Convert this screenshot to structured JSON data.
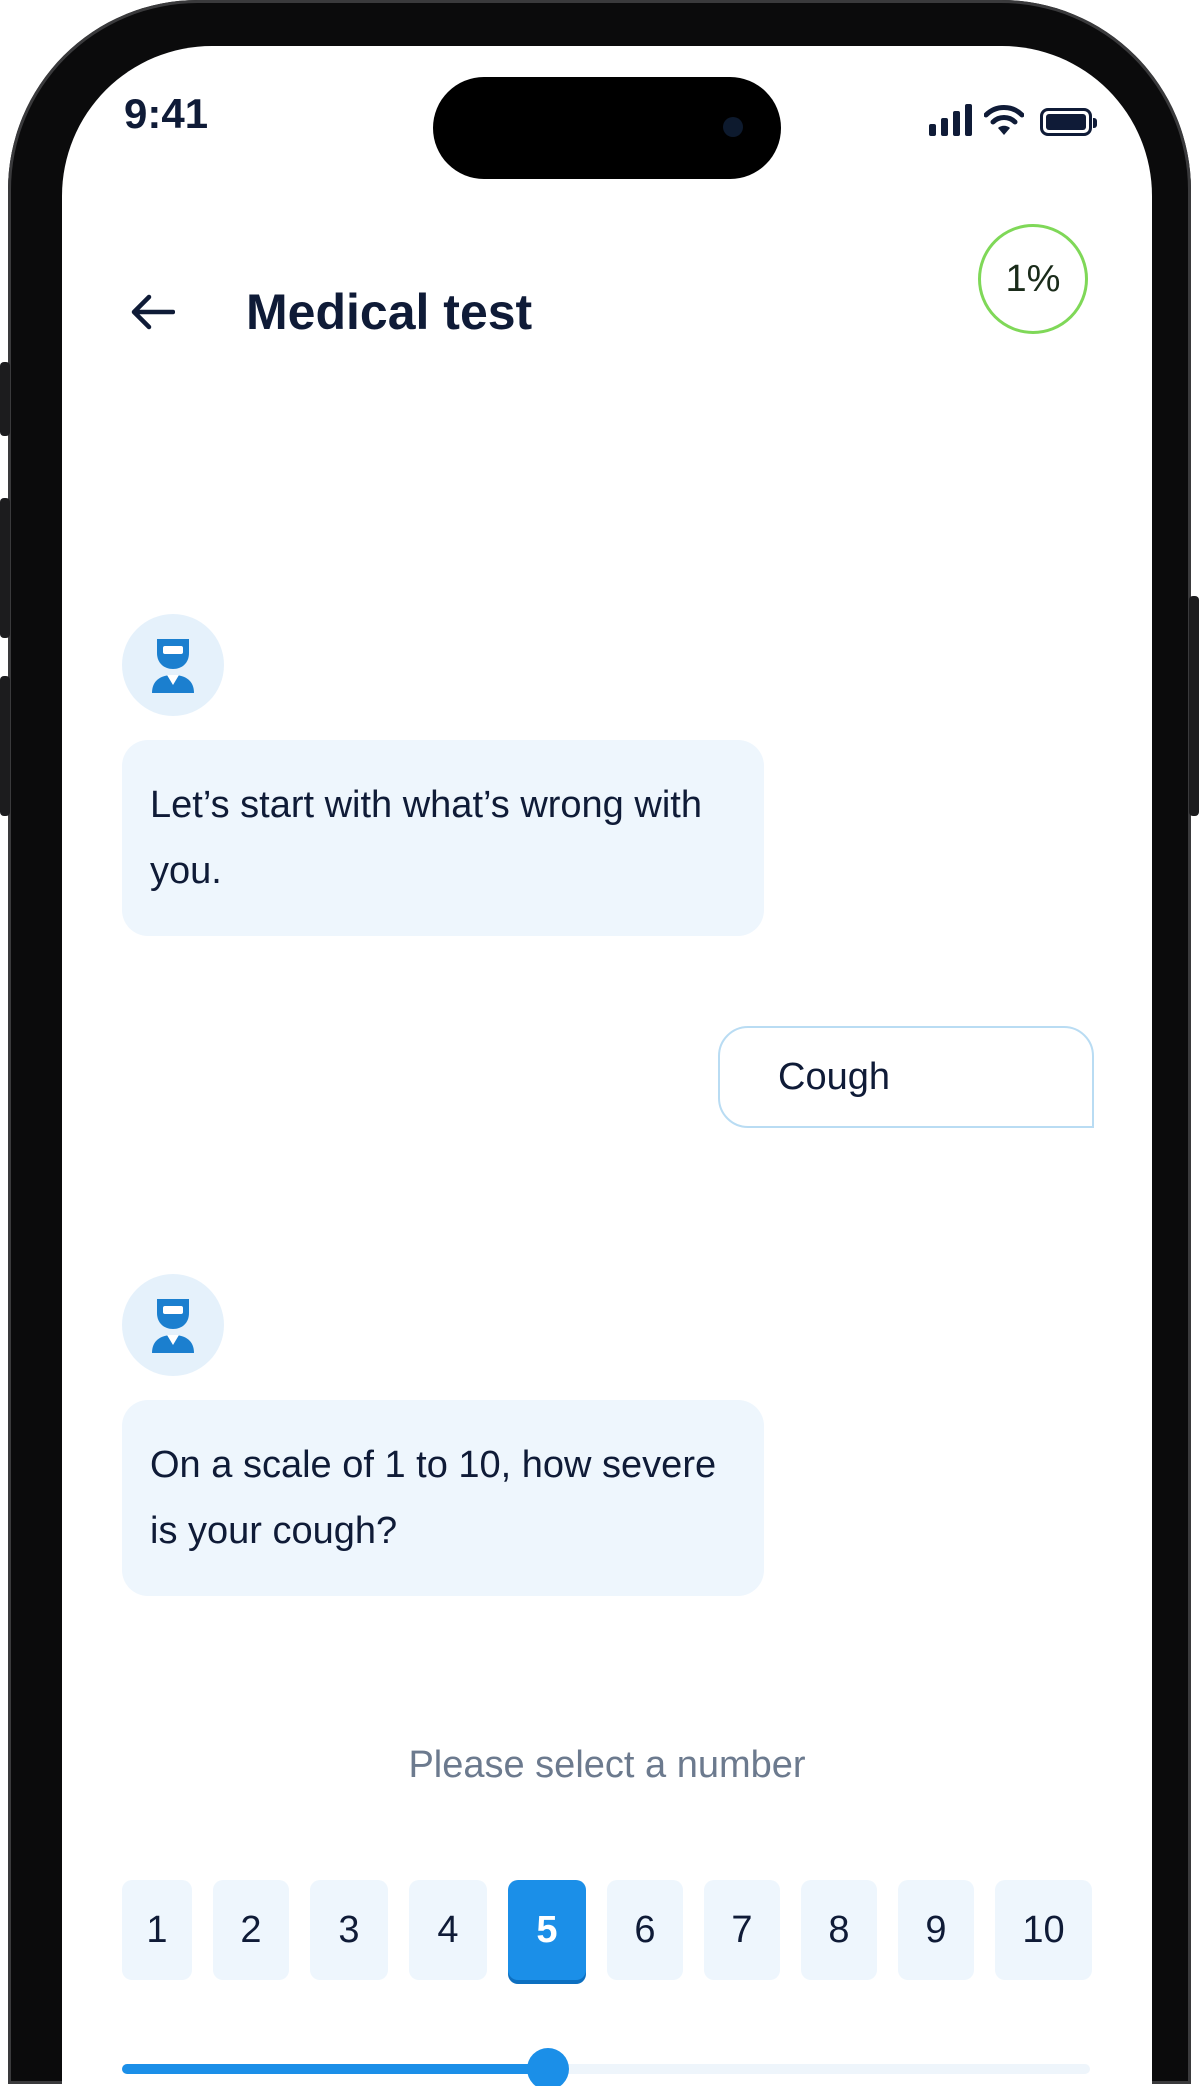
{
  "status_bar": {
    "time": "9:41",
    "icons": [
      "cellular-signal-icon",
      "wifi-icon",
      "battery-icon"
    ]
  },
  "header": {
    "back_icon": "arrow-left-icon",
    "title": "Medical test",
    "progress_label": "1%",
    "progress_value": 0.01,
    "progress_color": "#7fd858"
  },
  "chat": {
    "avatar_icon": "doctor-avatar-icon",
    "message_1": "Let’s start with what’s wrong with you.",
    "user_reply": "Cough",
    "message_2": "On a scale of 1 to 10, how severe is your cough?"
  },
  "rating": {
    "prompt": "Please select a number",
    "options": [
      "1",
      "2",
      "3",
      "4",
      "5",
      "6",
      "7",
      "8",
      "9",
      "10"
    ],
    "selected": "5",
    "slider_fraction": 0.44
  },
  "colors": {
    "accent": "#1b8fe8",
    "text": "#0f1b37",
    "bubble_bg": "#eef6fd"
  }
}
